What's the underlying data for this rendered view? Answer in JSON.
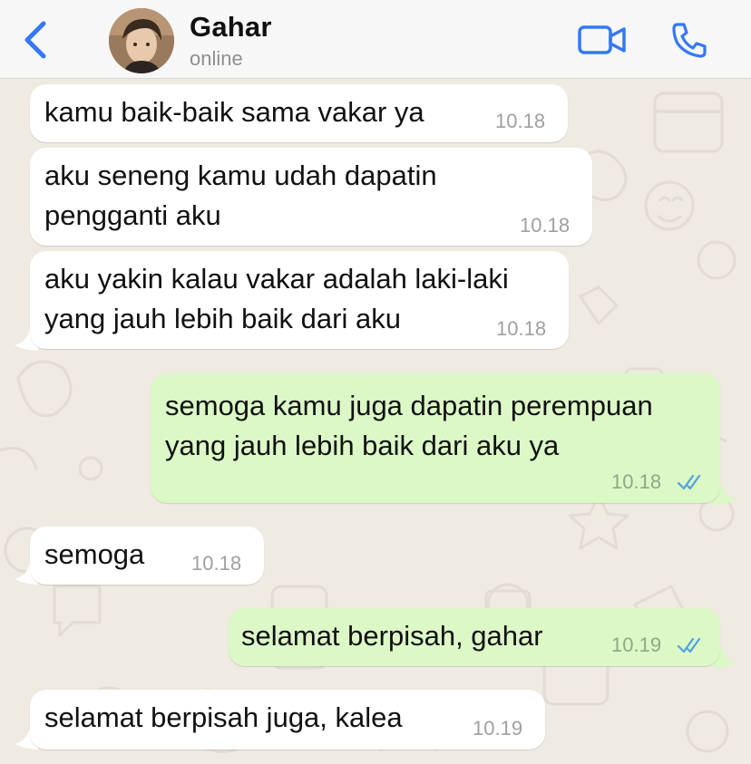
{
  "header": {
    "contact_name": "Gahar",
    "contact_status": "online",
    "back_icon": "chevron-left-icon",
    "video_icon": "video-camera-icon",
    "call_icon": "phone-icon",
    "accent_color": "#3478f6"
  },
  "messages": [
    {
      "direction": "incoming",
      "text": "kamu baik-baik sama vakar ya",
      "time": "10.18"
    },
    {
      "direction": "incoming",
      "text": "aku seneng kamu udah dapatin\npengganti aku",
      "time": "10.18"
    },
    {
      "direction": "incoming",
      "text": "aku yakin kalau vakar adalah laki-laki\nyang jauh lebih baik dari aku",
      "time": "10.18"
    },
    {
      "direction": "outgoing",
      "text": "semoga kamu juga dapatin perempuan\nyang jauh lebih baik dari aku ya",
      "time": "10.18",
      "status": "read"
    },
    {
      "direction": "incoming",
      "text": "semoga",
      "time": "10.18"
    },
    {
      "direction": "outgoing",
      "text": "selamat berpisah, gahar",
      "time": "10.19",
      "status": "read"
    },
    {
      "direction": "incoming",
      "text": "selamat berpisah juga, kalea",
      "time": "10.19"
    }
  ],
  "colors": {
    "incoming_bubble": "#ffffff",
    "outgoing_bubble": "#dcf8c6",
    "read_ticks": "#4fa3e0",
    "wallpaper": "#efeae2"
  }
}
